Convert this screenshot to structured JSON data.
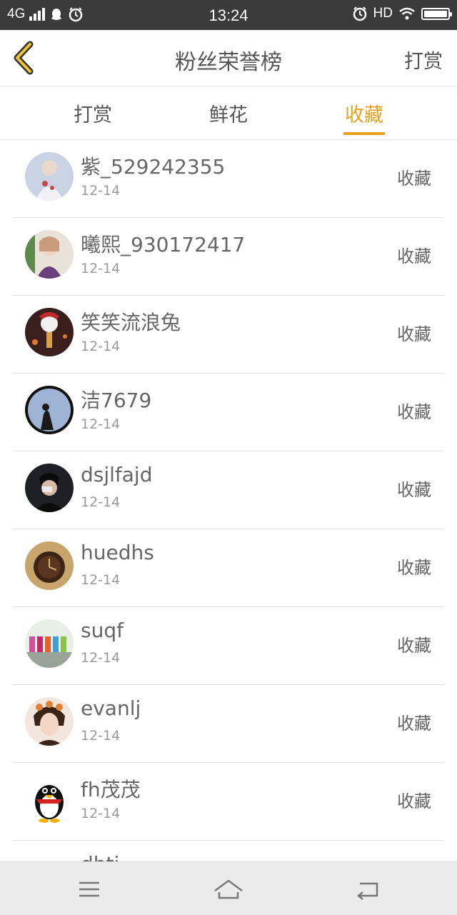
{
  "status_bar": {
    "network": "4G",
    "time": "13:24",
    "hd": "HD"
  },
  "header": {
    "back_icon": "chevron-left-icon",
    "title": "粉丝荣誉榜",
    "right_label": "打赏"
  },
  "tabs": [
    {
      "label": "打赏",
      "active": false
    },
    {
      "label": "鲜花",
      "active": false
    },
    {
      "label": "收藏",
      "active": true
    }
  ],
  "colors": {
    "accent": "#e8a020",
    "text": "#555555",
    "subtext": "#9a9a9a",
    "status_bar": "#3b3b3b"
  },
  "list": [
    {
      "name": "紫_529242355",
      "date": "12-14",
      "action": "收藏"
    },
    {
      "name": "曦熙_930172417",
      "date": "12-14",
      "action": "收藏"
    },
    {
      "name": "笑笑流浪兔",
      "date": "12-14",
      "action": "收藏"
    },
    {
      "name": "洁7679",
      "date": "12-14",
      "action": "收藏"
    },
    {
      "name": "dsjlfajd",
      "date": "12-14",
      "action": "收藏"
    },
    {
      "name": "huedhs",
      "date": "12-14",
      "action": "收藏"
    },
    {
      "name": "suqf",
      "date": "12-14",
      "action": "收藏"
    },
    {
      "name": "evanlj",
      "date": "12-14",
      "action": "收藏"
    },
    {
      "name": "fh茂茂",
      "date": "12-14",
      "action": "收藏"
    },
    {
      "name": "dhtj",
      "date": "",
      "action": ""
    }
  ],
  "nav": {
    "menu_icon": "menu-icon",
    "home_icon": "home-icon",
    "back_icon": "back-icon"
  }
}
